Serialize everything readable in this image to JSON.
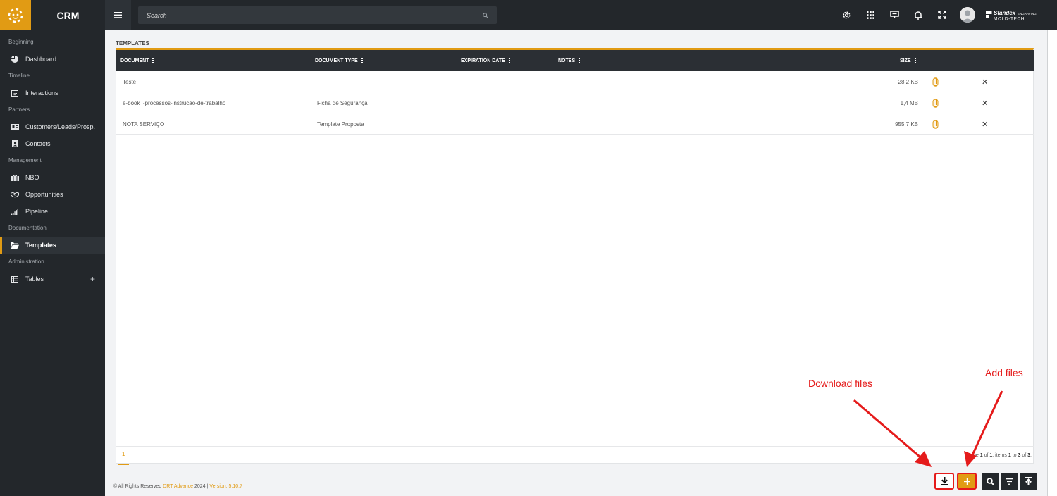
{
  "app": {
    "title": "CRM"
  },
  "search": {
    "placeholder": "Search"
  },
  "sidebar": {
    "sections": [
      {
        "label": "Beginning",
        "items": [
          {
            "label": "Dashboard",
            "icon": "pie-chart-icon"
          }
        ]
      },
      {
        "label": "Timeline",
        "items": [
          {
            "label": "Interactions",
            "icon": "calendar-icon"
          }
        ]
      },
      {
        "label": "Partners",
        "items": [
          {
            "label": "Customers/Leads/Prosp.",
            "icon": "id-card-icon"
          },
          {
            "label": "Contacts",
            "icon": "contact-book-icon"
          }
        ]
      },
      {
        "label": "Management",
        "items": [
          {
            "label": "NBO",
            "icon": "briefcase-icon"
          },
          {
            "label": "Opportunities",
            "icon": "handshake-icon"
          },
          {
            "label": "Pipeline",
            "icon": "signal-bars-icon"
          }
        ]
      },
      {
        "label": "Documentation",
        "items": [
          {
            "label": "Templates",
            "icon": "folder-open-icon",
            "active": true
          }
        ]
      },
      {
        "label": "Administration",
        "items": [
          {
            "label": "Tables",
            "icon": "table-icon"
          }
        ]
      }
    ]
  },
  "main": {
    "section_title": "TEMPLATES",
    "columns": {
      "document": "DOCUMENT",
      "document_type": "DOCUMENT TYPE",
      "expiration_date": "EXPIRATION DATE",
      "notes": "NOTES",
      "size": "SIZE"
    },
    "rows": [
      {
        "document": "Teste",
        "document_type": "",
        "expiration_date": "",
        "notes": "",
        "size": "28,2 KB"
      },
      {
        "document": "e-book_-processos-instrucao-de-trabalho",
        "document_type": "Ficha de Segurança",
        "expiration_date": "",
        "notes": "",
        "size": "1,4 MB"
      },
      {
        "document": "NOTA SERVIÇO",
        "document_type": "Template Proposta",
        "expiration_date": "",
        "notes": "",
        "size": "955,7 KB"
      }
    ],
    "pager": {
      "current_page": "1",
      "info_prefix": "Page ",
      "info_page": "1",
      "info_of": " of ",
      "info_total_pages": "1",
      "info_items": ", items ",
      "info_from": "1",
      "info_to_word": " to ",
      "info_to": "3",
      "info_of2": " of ",
      "info_count": "3",
      "info_end": "."
    }
  },
  "footer": {
    "prefix": "© All Rights Reserved ",
    "company": "DRT Advance",
    "year": " 2024 | ",
    "version": "Version: 5.10.7"
  },
  "annotations": {
    "download": "Download files",
    "add": "Add files"
  },
  "brand": {
    "line1": "Standex",
    "line2": "ENGRAVING",
    "line3": "MOLD-TECH"
  },
  "colors": {
    "accent": "#e19b14",
    "dark": "#23272b",
    "annotation": "#e51b1b"
  }
}
